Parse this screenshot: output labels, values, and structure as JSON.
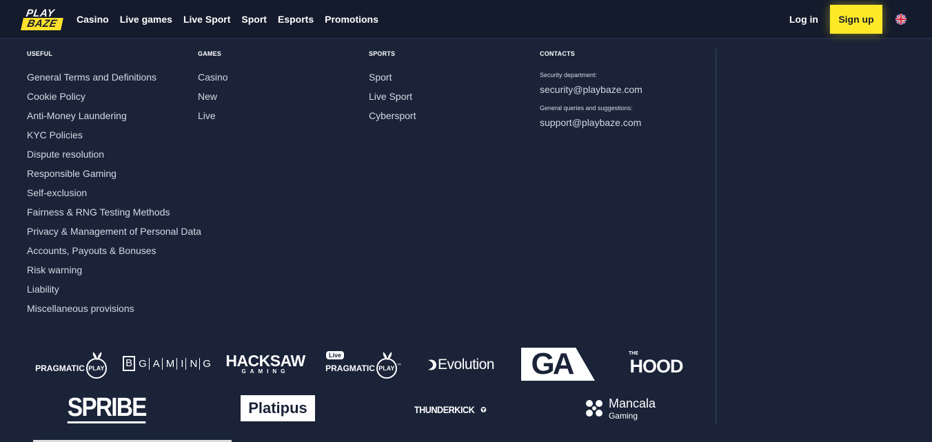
{
  "header": {
    "logo": {
      "top": "PLAY",
      "bottom": "BAZE"
    },
    "nav": [
      "Casino",
      "Live games",
      "Live Sport",
      "Sport",
      "Esports",
      "Promotions"
    ],
    "login_label": "Log in",
    "signup_label": "Sign up",
    "language_icon": "uk-flag-icon"
  },
  "footer": {
    "useful": {
      "title": "USEFUL",
      "links": [
        "General Terms and Definitions",
        "Cookie Policy",
        "Anti-Money Laundering",
        "KYC Policies",
        "Dispute resolution",
        "Responsible Gaming",
        "Self-exclusion",
        "Fairness & RNG Testing Methods",
        "Privacy & Management of Personal Data",
        "Accounts, Payouts & Bonuses",
        "Risk warning",
        "Liability",
        "Miscellaneous provisions"
      ]
    },
    "games": {
      "title": "GAMES",
      "links": [
        "Casino",
        "New",
        "Live"
      ]
    },
    "sports": {
      "title": "SPORTS",
      "links": [
        "Sport",
        "Live Sport",
        "Cybersport"
      ]
    },
    "contacts": {
      "title": "CONTACTS",
      "security_label": "Security department:",
      "security_email": "security@playbaze.com",
      "general_label": "General queries and suggestions:",
      "general_email": "support@playbaze.com"
    }
  },
  "providers": {
    "pragmatic": {
      "word": "PRAGMATIC",
      "play": "PLAY"
    },
    "bgaming": {
      "letters": [
        "B",
        "G",
        "A",
        "M",
        "I",
        "N",
        "G"
      ]
    },
    "hacksaw": {
      "word": "HACKSAW",
      "sub": "GAMING"
    },
    "pragmatic_live": {
      "badge": "Live",
      "word": "PRAGMATIC",
      "play": "PLAY",
      "tm": "™"
    },
    "evolution": {
      "word": "Evolution"
    },
    "ga": {
      "word": "GA"
    },
    "hood": {
      "the": "THE",
      "word": "HOOD"
    },
    "spribe": {
      "word": "SPRIBE"
    },
    "platipus": {
      "word": "Platipus"
    },
    "thunderkick": {
      "word": "THUNDERKICK"
    },
    "mancala": {
      "word": "Mancala",
      "sub": "Gaming"
    }
  },
  "colors": {
    "background": "#1a2338",
    "header": "#131b2c",
    "accent": "#ffe927"
  }
}
